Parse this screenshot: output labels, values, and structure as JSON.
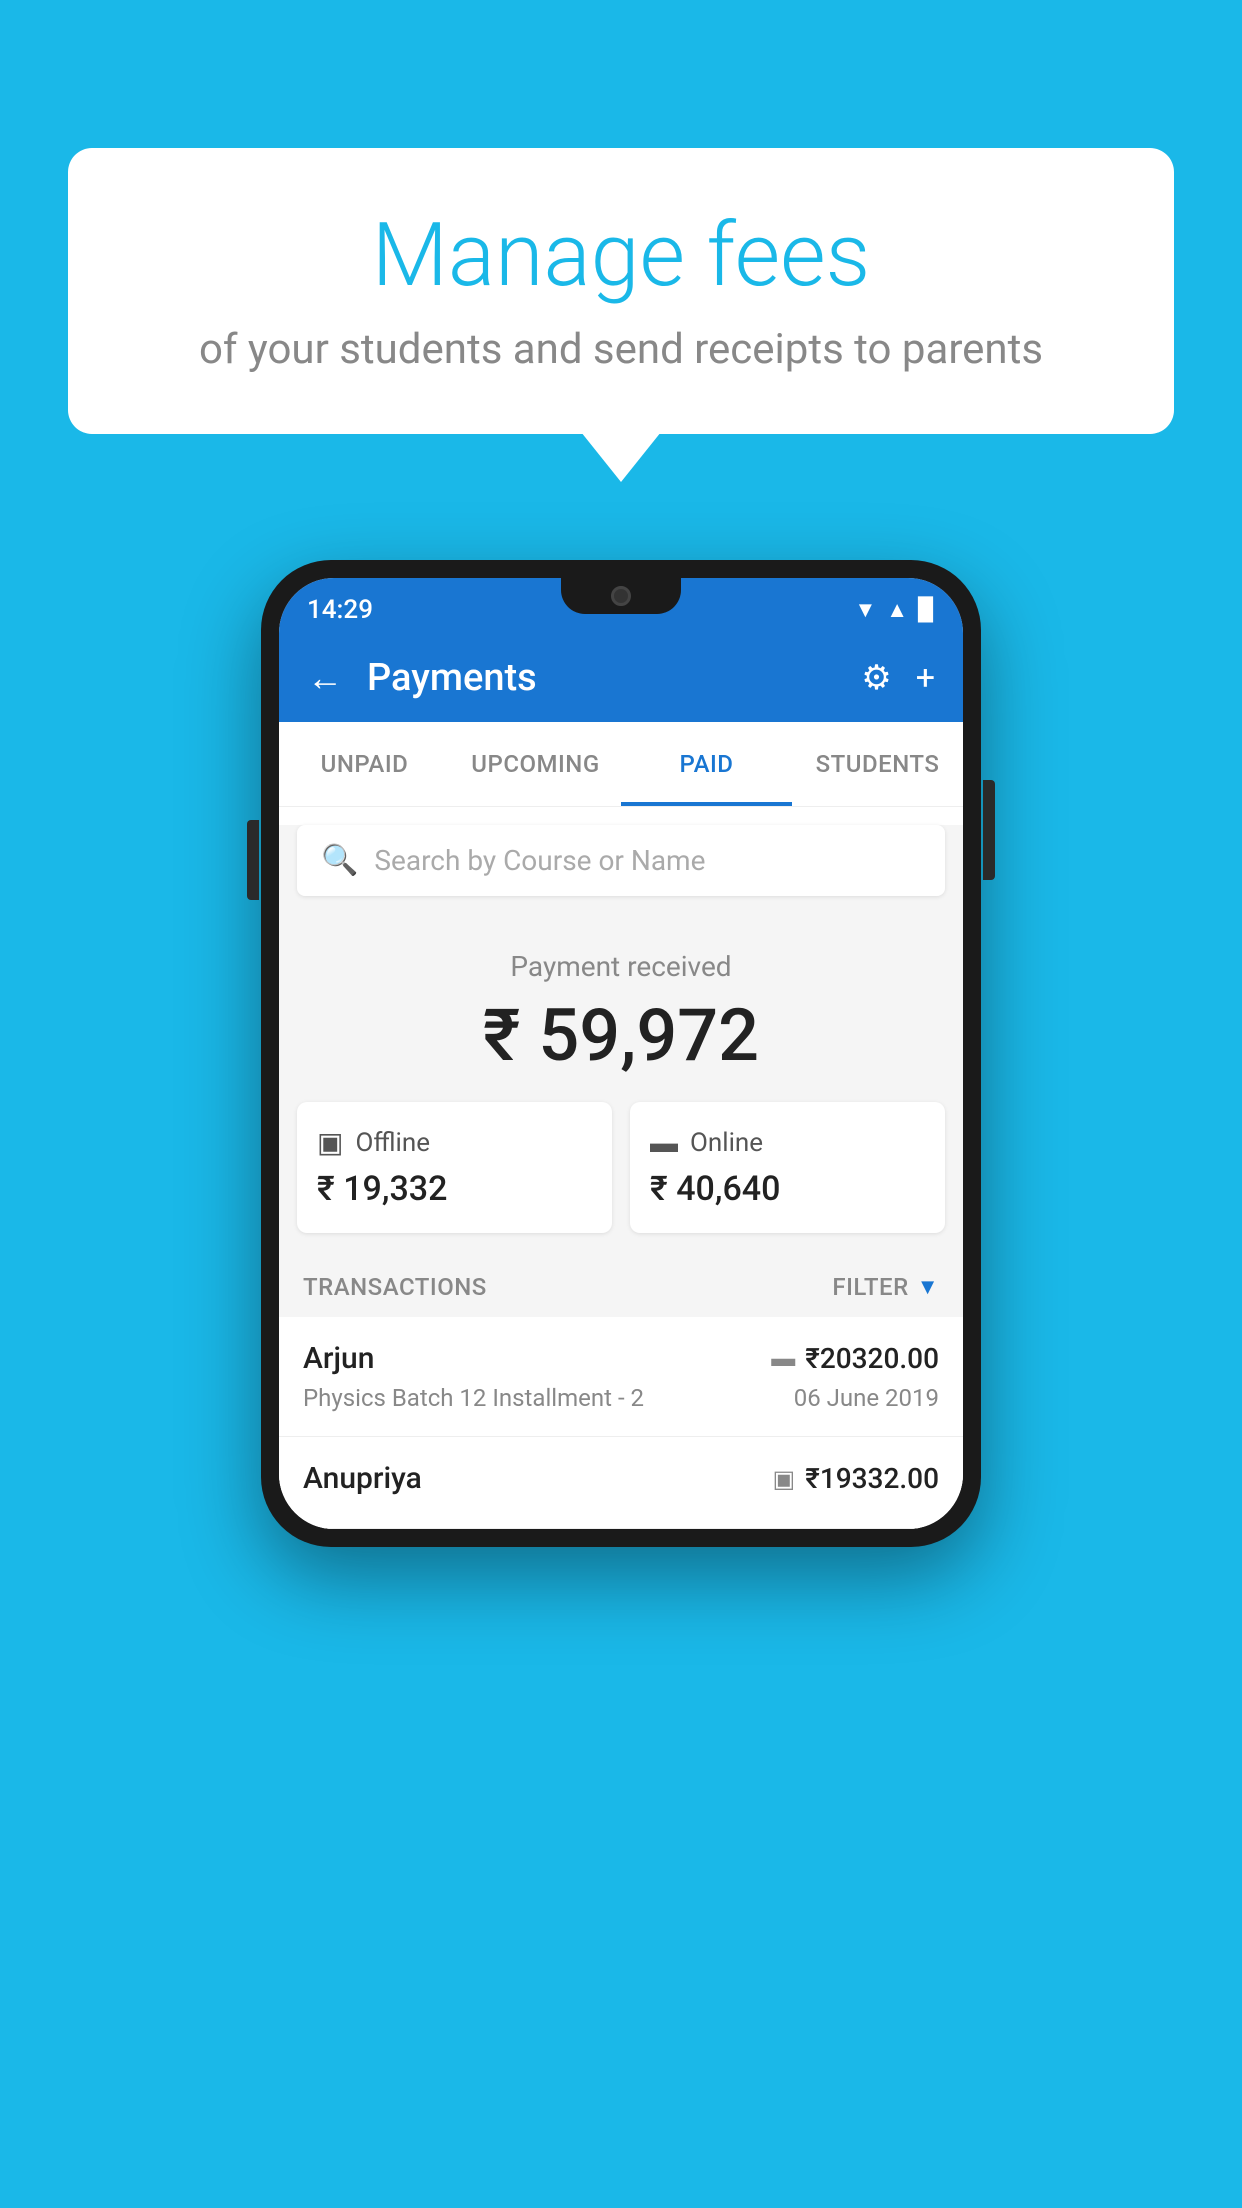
{
  "background_color": "#1ab8e8",
  "bubble": {
    "title": "Manage fees",
    "subtitle": "of your students and send receipts to parents"
  },
  "status_bar": {
    "time": "14:29",
    "wifi": "▲",
    "signal": "▲",
    "battery": "▉"
  },
  "app_bar": {
    "title": "Payments",
    "back_label": "←",
    "settings_label": "⚙",
    "add_label": "+"
  },
  "tabs": [
    {
      "label": "UNPAID",
      "active": false
    },
    {
      "label": "UPCOMING",
      "active": false
    },
    {
      "label": "PAID",
      "active": true
    },
    {
      "label": "STUDENTS",
      "active": false
    }
  ],
  "search": {
    "placeholder": "Search by Course or Name"
  },
  "payment_received": {
    "label": "Payment received",
    "amount": "₹ 59,972"
  },
  "offline_card": {
    "icon": "wallet",
    "label": "Offline",
    "amount": "₹ 19,332"
  },
  "online_card": {
    "icon": "card",
    "label": "Online",
    "amount": "₹ 40,640"
  },
  "transactions": {
    "label": "TRANSACTIONS",
    "filter_label": "FILTER"
  },
  "transaction_list": [
    {
      "name": "Arjun",
      "course": "Physics Batch 12 Installment - 2",
      "amount": "₹20320.00",
      "date": "06 June 2019",
      "type": "online"
    },
    {
      "name": "Anupriya",
      "course": "",
      "amount": "₹19332.00",
      "date": "",
      "type": "offline"
    }
  ]
}
